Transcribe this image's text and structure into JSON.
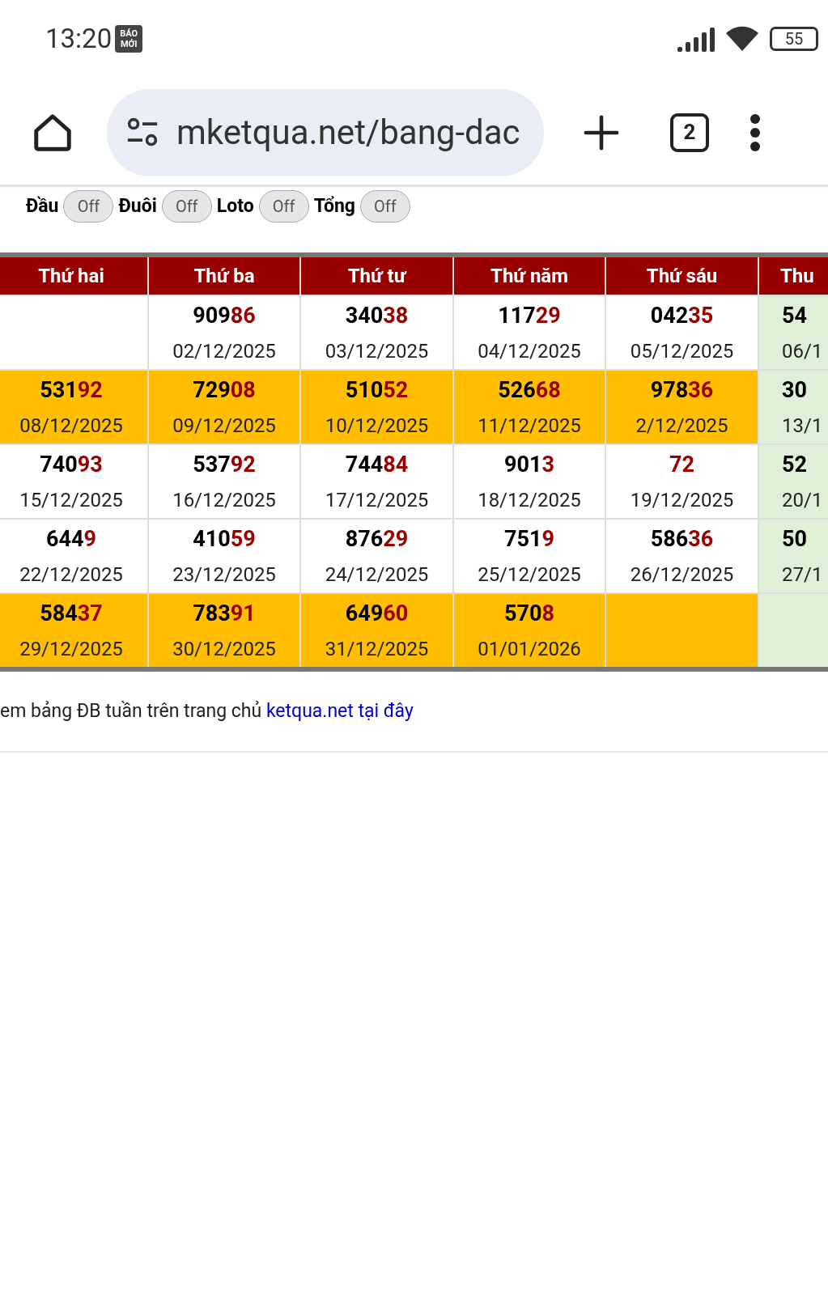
{
  "status_bar": {
    "time": "13:20",
    "app_badge": "BÁO MỚI",
    "battery": "55"
  },
  "browser": {
    "url": "mketqua.net/bang-dac",
    "tab_count": "2"
  },
  "toggles": [
    {
      "label": "Đầu",
      "text": "Off",
      "on": false
    },
    {
      "label": "Đuôi",
      "text": "Off",
      "on": false
    },
    {
      "label": "Loto",
      "text": "Off",
      "on": false
    },
    {
      "label": "Tổng",
      "text": "Off",
      "on": false
    }
  ],
  "table": {
    "columns": [
      "Thứ hai",
      "Thứ ba",
      "Thứ tư",
      "Thứ năm",
      "Thứ sáu",
      "Thu"
    ],
    "rows": [
      {
        "highlight": false,
        "cells": [
          {},
          {
            "head": "909",
            "tail": "86",
            "date": "02/12/2025"
          },
          {
            "head": "340",
            "tail": "38",
            "date": "03/12/2025"
          },
          {
            "head": "117",
            "tail": "29",
            "date": "04/12/2025"
          },
          {
            "head": "042",
            "tail": "35",
            "date": "05/12/2025"
          },
          {
            "head": "54",
            "date": "06/1"
          }
        ]
      },
      {
        "highlight": true,
        "cells": [
          {
            "head": "531",
            "tail": "92",
            "date": "08/12/2025"
          },
          {
            "head": "729",
            "tail": "08",
            "date": "09/12/2025"
          },
          {
            "head": "510",
            "tail": "52",
            "date": "10/12/2025"
          },
          {
            "head": "526",
            "tail": "68",
            "date": "11/12/2025"
          },
          {
            "head": "978",
            "tail": "36",
            "date": "2/12/2025"
          },
          {
            "head": "30",
            "date": "13/1"
          }
        ]
      },
      {
        "highlight": false,
        "cells": [
          {
            "head": "740",
            "tail": "93",
            "date": "15/12/2025"
          },
          {
            "head": "537",
            "tail": "92",
            "date": "16/12/2025"
          },
          {
            "head": "744",
            "tail": "84",
            "date": "17/12/2025"
          },
          {
            "head": "901",
            "tail": "3",
            "date": "18/12/2025"
          },
          {
            "tail": "72",
            "date": "19/12/2025"
          },
          {
            "head": "52",
            "date": "20/1"
          }
        ]
      },
      {
        "highlight": false,
        "cells": [
          {
            "head": "644",
            "tail": "9",
            "date": "22/12/2025"
          },
          {
            "head": "410",
            "tail": "59",
            "date": "23/12/2025"
          },
          {
            "head": "876",
            "tail": "29",
            "date": "24/12/2025"
          },
          {
            "head": "751",
            "tail": "9",
            "date": "25/12/2025"
          },
          {
            "head": "586",
            "tail": "36",
            "date": "26/12/2025"
          },
          {
            "head": "50",
            "date": "27/1"
          }
        ]
      },
      {
        "highlight": true,
        "cells": [
          {
            "head": "584",
            "tail": "37",
            "date": "29/12/2025"
          },
          {
            "head": "783",
            "tail": "91",
            "date": "30/12/2025"
          },
          {
            "head": "649",
            "tail": "60",
            "date": "31/12/2025"
          },
          {
            "head": "570",
            "tail": "8",
            "date": "01/01/2026"
          },
          {},
          {}
        ]
      }
    ]
  },
  "footer": {
    "text": "em bảng ĐB tuần trên trang chủ",
    "link": "ketqua.net tại đây"
  }
}
